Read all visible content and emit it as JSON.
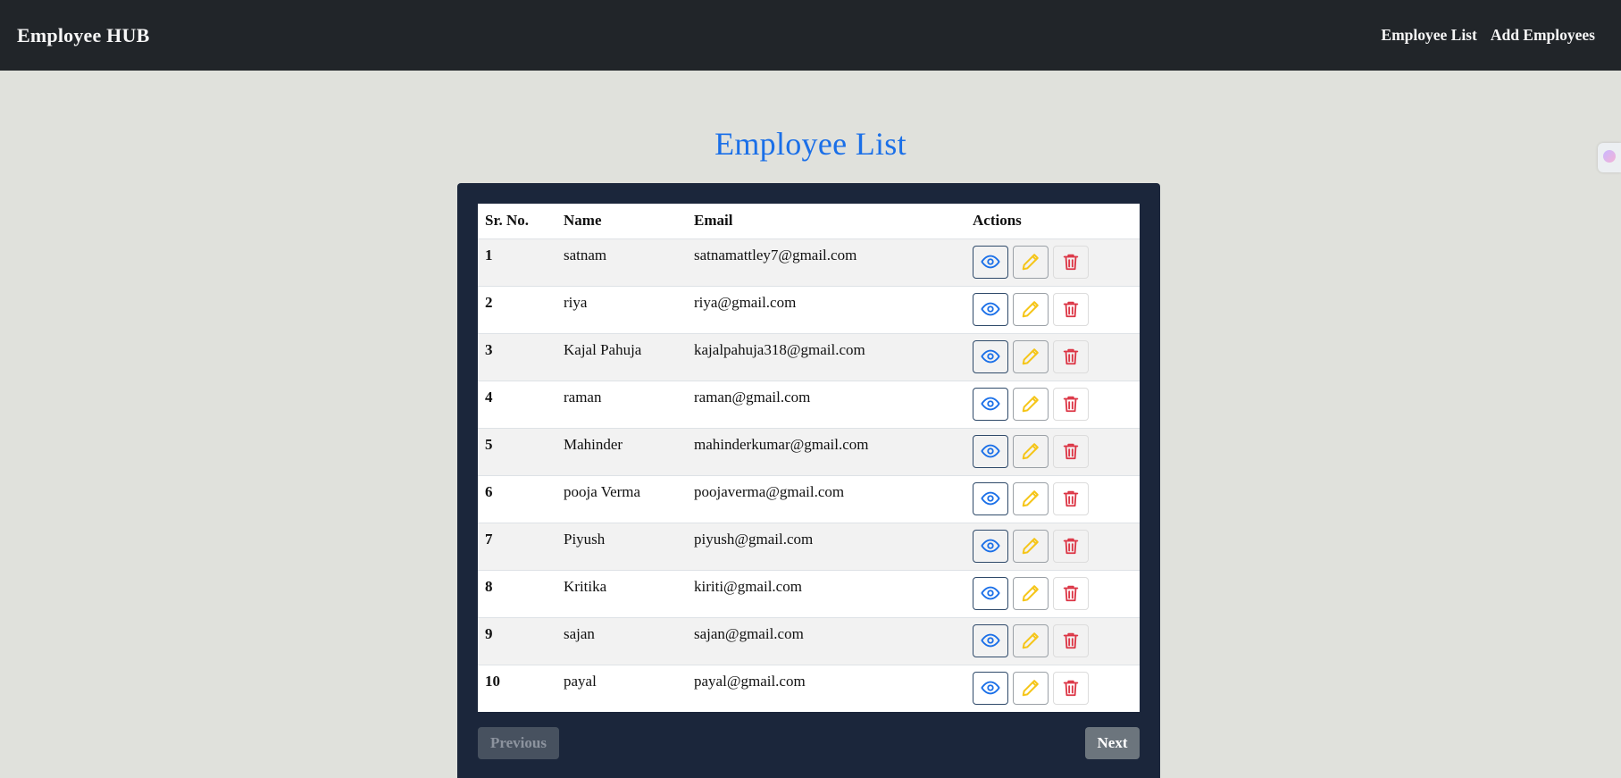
{
  "navbar": {
    "brand": "Employee HUB",
    "links": [
      "Employee List",
      "Add Employees"
    ]
  },
  "page": {
    "title": "Employee List"
  },
  "table": {
    "headers": [
      "Sr. No.",
      "Name",
      "Email",
      "Actions"
    ],
    "rows": [
      {
        "sr": "1",
        "name": "satnam",
        "email": "satnamattley7@gmail.com"
      },
      {
        "sr": "2",
        "name": "riya",
        "email": "riya@gmail.com"
      },
      {
        "sr": "3",
        "name": "Kajal Pahuja",
        "email": "kajalpahuja318@gmail.com"
      },
      {
        "sr": "4",
        "name": "raman",
        "email": "raman@gmail.com"
      },
      {
        "sr": "5",
        "name": "Mahinder",
        "email": "mahinderkumar@gmail.com"
      },
      {
        "sr": "6",
        "name": "pooja Verma",
        "email": "poojaverma@gmail.com"
      },
      {
        "sr": "7",
        "name": "Piyush",
        "email": "piyush@gmail.com"
      },
      {
        "sr": "8",
        "name": "Kritika",
        "email": "kiriti@gmail.com"
      },
      {
        "sr": "9",
        "name": "sajan",
        "email": "sajan@gmail.com"
      },
      {
        "sr": "10",
        "name": "payal",
        "email": "payal@gmail.com"
      }
    ],
    "action_icons": [
      "eye-icon",
      "pencil-icon",
      "trash-icon"
    ]
  },
  "pagination": {
    "previous": "Previous",
    "next": "Next",
    "previous_disabled": true
  },
  "colors": {
    "navbar": "#212529",
    "title": "#1a6fe8",
    "card": "#1b263b",
    "view": "#1a6fe8",
    "edit": "#f5c518",
    "delete": "#dc3545"
  }
}
